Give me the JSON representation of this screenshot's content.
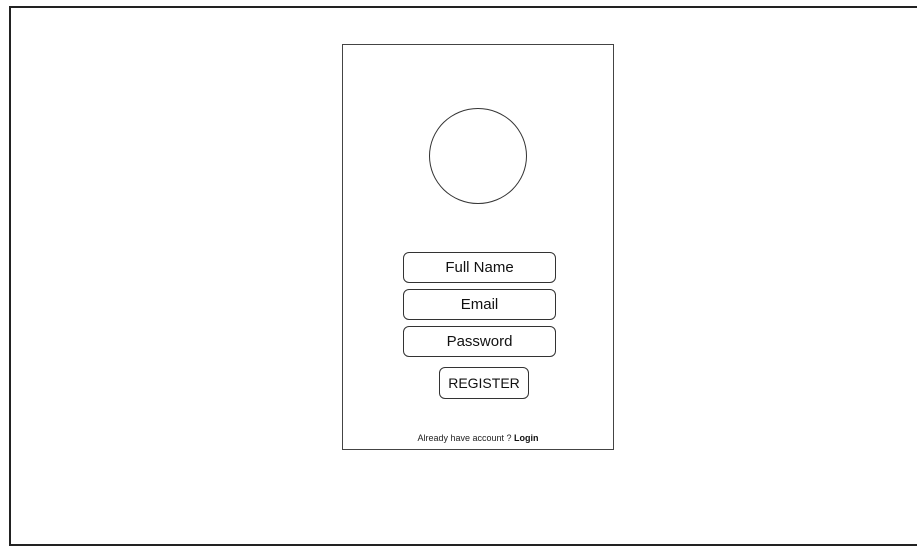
{
  "form": {
    "full_name_placeholder": "Full Name",
    "email_placeholder": "Email",
    "password_placeholder": "Password",
    "register_label": "REGISTER"
  },
  "footer": {
    "prompt": "Already have account ?",
    "login_label": "Login"
  },
  "colors": {
    "border": "#333333",
    "background": "#ffffff",
    "text": "#111111"
  },
  "icons": {
    "avatar": "avatar-placeholder-circle"
  }
}
